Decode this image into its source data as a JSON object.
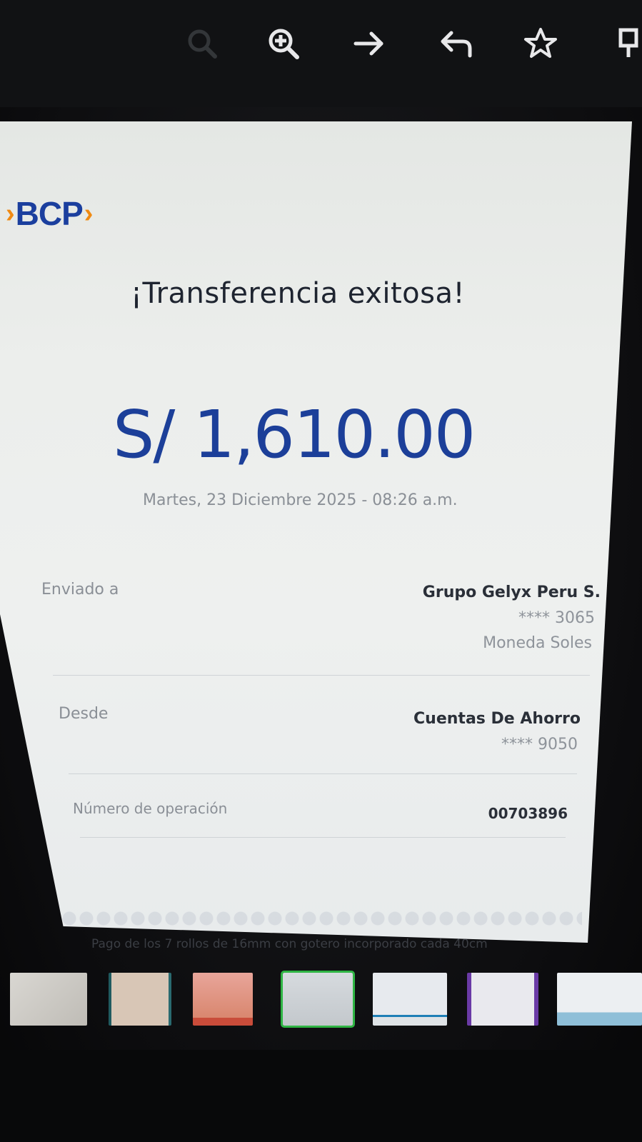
{
  "toolbar": {
    "icons": [
      "search-icon",
      "zoom-in-icon",
      "forward-arrow-icon",
      "reply-icon",
      "star-icon",
      "pin-icon"
    ]
  },
  "receipt": {
    "logo_text": "BCP",
    "title": "¡Transferencia exitosa!",
    "amount": "S/ 1,610.00",
    "datetime": "Martes, 23 Diciembre 2025 - 08:26 a.m.",
    "sent_to": {
      "label": "Enviado a",
      "name": "Grupo Gelyx Peru S.",
      "account": "**** 3065",
      "currency": "Moneda Soles"
    },
    "from": {
      "label": "Desde",
      "name": "Cuentas De Ahorro",
      "account": "**** 9050"
    },
    "operation": {
      "label": "Número de operación",
      "number": "00703896"
    }
  },
  "gallery": {
    "caption": "Pago de los 7 rollos de 16mm con gotero incorporado cada 40cm",
    "thumbnails": [
      "thumbnail-1",
      "thumbnail-2",
      "thumbnail-3",
      "thumbnail-4",
      "thumbnail-5",
      "thumbnail-6",
      "thumbnail-7"
    ],
    "selected_index": 4
  },
  "colors": {
    "brand_blue": "#1c3f99",
    "brand_orange": "#f08a12",
    "selection_green": "#2fb544"
  }
}
